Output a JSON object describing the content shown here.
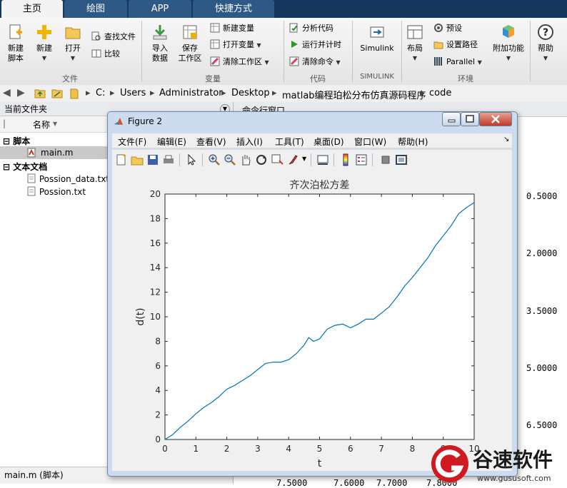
{
  "tabs": [
    {
      "label": "主页",
      "active": true
    },
    {
      "label": "绘图",
      "active": false
    },
    {
      "label": "APP",
      "active": false
    },
    {
      "label": "快捷方式",
      "active": false
    }
  ],
  "ribbon": {
    "file": {
      "new_script": "新建\n脚本",
      "new": "新建",
      "open": "打开",
      "find_files": "查找文件",
      "compare": "比较",
      "group": "文件"
    },
    "variable": {
      "import": "导入\n数据",
      "save_ws": "保存\n工作区",
      "new_var": "新建变量",
      "open_var": "打开变量",
      "clear_ws": "清除工作区",
      "group": "变量"
    },
    "code": {
      "analyze": "分析代码",
      "run_time": "运行并计时",
      "clear_cmd": "清除命令",
      "group": "代码"
    },
    "simulink": {
      "label": "Simulink",
      "group": "SIMULINK"
    },
    "env": {
      "layout": "布局",
      "prefs": "预设",
      "set_path": "设置路径",
      "parallel": "Parallel",
      "addons": "附加功能",
      "group": "环境"
    },
    "help": "帮助"
  },
  "address": {
    "crumbs": [
      "C:",
      "Users",
      "Administrator",
      "Desktop",
      "matlab编程珀松分布仿真源码程序",
      "code"
    ]
  },
  "left_panel": {
    "title": "当前文件夹",
    "col_name": "名称",
    "group_scripts": "脚本",
    "file_main": "main.m",
    "group_text": "文本文档",
    "file_data": "Possion_data.txt",
    "file_txt": "Possion.txt",
    "status": "main.m  (脚本)"
  },
  "right_panel": {
    "title": "命令行窗口",
    "values": [
      "0.5000",
      "2.0000",
      "3.5000",
      "5.0000",
      "6.5000"
    ],
    "bottom_values": [
      "7.5000",
      "7.6000",
      "7.7000",
      "7.8000"
    ]
  },
  "figure": {
    "title": "Figure 2",
    "menu": [
      "文件(F)",
      "编辑(E)",
      "查看(V)",
      "插入(I)",
      "工具(T)",
      "桌面(D)",
      "窗口(W)",
      "帮助(H)"
    ]
  },
  "chart_data": {
    "type": "line",
    "title": "齐次泊松方差",
    "xlabel": "t",
    "ylabel": "d(t)",
    "xlim": [
      0,
      10
    ],
    "ylim": [
      0,
      20
    ],
    "xticks": [
      0,
      1,
      2,
      3,
      4,
      5,
      6,
      7,
      8,
      9,
      10
    ],
    "yticks": [
      0,
      2,
      4,
      6,
      8,
      10,
      12,
      14,
      16,
      18,
      20
    ],
    "grid": false,
    "color": "#0072bd",
    "x": [
      0,
      0.25,
      0.5,
      0.75,
      1.0,
      1.25,
      1.5,
      1.75,
      2.0,
      2.25,
      2.5,
      2.75,
      3.0,
      3.25,
      3.5,
      3.75,
      4.0,
      4.25,
      4.5,
      4.65,
      4.8,
      5.0,
      5.25,
      5.5,
      5.75,
      6.0,
      6.25,
      6.5,
      6.75,
      7.0,
      7.25,
      7.5,
      7.75,
      8.0,
      8.25,
      8.5,
      8.75,
      9.0,
      9.25,
      9.5,
      9.75,
      10.0
    ],
    "y": [
      0,
      0.4,
      1.0,
      1.5,
      2.1,
      2.6,
      3.0,
      3.5,
      4.1,
      4.4,
      4.8,
      5.2,
      5.7,
      6.2,
      6.3,
      6.3,
      6.5,
      7.0,
      7.7,
      8.3,
      8.0,
      8.2,
      9.0,
      9.3,
      9.4,
      9.1,
      9.4,
      9.8,
      9.8,
      10.3,
      10.8,
      11.6,
      12.5,
      13.2,
      14.0,
      14.8,
      15.8,
      16.6,
      17.4,
      18.4,
      18.9,
      19.3
    ]
  },
  "watermark": {
    "brand": "谷速软件",
    "url": "www.gususoft.com"
  }
}
